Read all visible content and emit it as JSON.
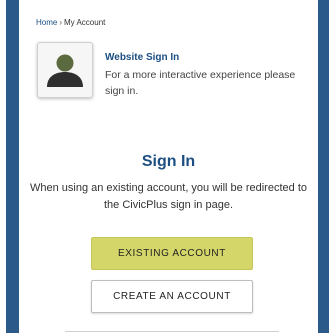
{
  "breadcrumb": {
    "home": "Home",
    "separator": "›",
    "current": "My Account"
  },
  "signin_box": {
    "icon": "user-avatar-icon",
    "title": "Website Sign In",
    "description": "For a more interactive experience please sign in."
  },
  "main": {
    "heading": "Sign In",
    "explanation": "When using an existing account, you will be redirected to the CivicPlus sign in page."
  },
  "buttons": {
    "existing": "EXISTING ACCOUNT",
    "create": "CREATE AN ACCOUNT"
  },
  "colors": {
    "frame": "#2b5a8a",
    "accent_text": "#1d4f82",
    "existing_button": "#d5d66a"
  }
}
